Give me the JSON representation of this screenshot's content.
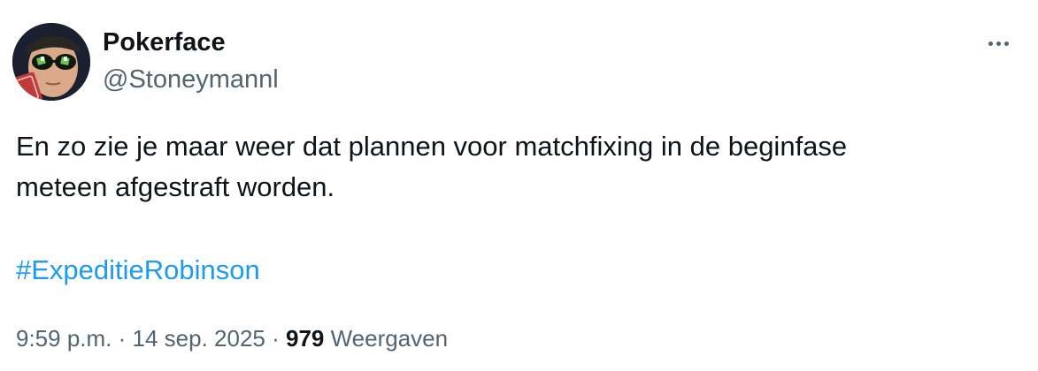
{
  "author": {
    "display_name": "Pokerface",
    "handle": "@Stoneymannl"
  },
  "tweet": {
    "text_line1": "En zo zie je maar weer dat plannen voor matchfixing in de beginfase",
    "text_line2": "meteen afgestraft worden.",
    "hashtag": "#ExpeditieRobinson"
  },
  "meta": {
    "time": "9:59 p.m.",
    "separator": " · ",
    "date": "14 sep. 2025",
    "views_count": "979",
    "views_label": "Weergaven"
  },
  "icons": {
    "more": "more-horizontal-icon"
  },
  "colors": {
    "text": "#0f1419",
    "secondary": "#536471",
    "link": "#1d9bf0"
  }
}
